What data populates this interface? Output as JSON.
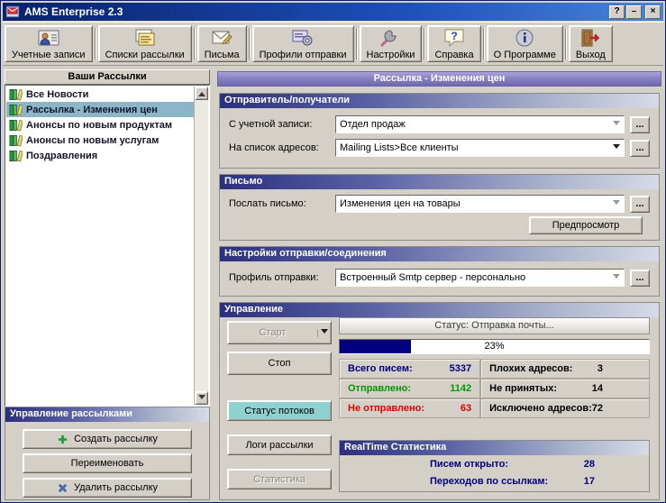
{
  "window": {
    "title": "AMS Enterprise 2.3",
    "help": "?",
    "minimize": "–",
    "close": "×"
  },
  "toolbar": {
    "items": [
      {
        "label": "Учетные записи",
        "icon": "accounts-icon"
      },
      {
        "label": "Списки рассылки",
        "icon": "mailing-lists-icon"
      },
      {
        "label": "Письма",
        "icon": "letters-icon"
      },
      {
        "label": "Профили отправки",
        "icon": "send-profiles-icon"
      },
      {
        "label": "Настройки",
        "icon": "settings-icon"
      },
      {
        "label": "Справка",
        "icon": "help-icon"
      },
      {
        "label": "О Программе",
        "icon": "about-icon"
      },
      {
        "label": "Выход",
        "icon": "exit-icon"
      }
    ]
  },
  "sidebar": {
    "header": "Ваши Рассылки",
    "items": [
      {
        "label": "Все Новости",
        "selected": false
      },
      {
        "label": "Рассылка - Изменения цен",
        "selected": true
      },
      {
        "label": "Анонсы по новым продуктам",
        "selected": false
      },
      {
        "label": "Анонсы по новым услугам",
        "selected": false
      },
      {
        "label": "Поздравления",
        "selected": false
      }
    ],
    "management": {
      "header": "Управление рассылками",
      "create_label": "Создать рассылку",
      "rename_label": "Переименовать",
      "delete_label": "Удалить рассылку"
    }
  },
  "main": {
    "title": "Рассылка - Изменения цен",
    "sender": {
      "header": "Отправитель/получатели",
      "account_label": "С учетной записи:",
      "account_value": "Отдел продаж",
      "list_label": "На список адресов:",
      "list_value": "Mailing Lists>Все клиенты"
    },
    "letter": {
      "header": "Письмо",
      "label": "Послать письмо:",
      "value": "Изменения цен на товары",
      "preview_label": "Предпросмотр"
    },
    "send_settings": {
      "header": "Настройки отправки/соединения",
      "profile_label": "Профиль отправки:",
      "profile_value": "Встроенный Smtp сервер - персонально"
    },
    "control": {
      "header": "Управление",
      "start_label": "Старт",
      "stop_label": "Стоп",
      "threads_label": "Статус потоков",
      "logs_label": "Логи рассылки",
      "stats_label": "Статистика",
      "status_text": "Статус: Отправка почты...",
      "progress_percent": "23%",
      "progress_value": 23,
      "stats": [
        {
          "label": "Всего писем:",
          "value": "5337"
        },
        {
          "label": "Плохих адресов:",
          "value": "3"
        },
        {
          "label": "Отправлено:",
          "value": "1142"
        },
        {
          "label": "Не принятых:",
          "value": "14"
        },
        {
          "label": "Не отправлено:",
          "value": "63"
        },
        {
          "label": "Исключено адресов:",
          "value": "72"
        }
      ],
      "realtime": {
        "header": "RealTime Статистика",
        "opened_label": "Писем открыто:",
        "opened_value": "28",
        "clicks_label": "Переходов по ссылкам:",
        "clicks_value": "17"
      }
    }
  },
  "ui": {
    "browse_label": "...",
    "icons": {
      "dropdown": "triangle-down-css-shape",
      "scroll_up": "triangle-up-css-shape",
      "scroll_down": "triangle-down-css-shape",
      "create": "green-plus",
      "delete": "blue-cross",
      "list_item": "books-stack"
    }
  },
  "colors": {
    "titlebar_blue": "#1d4fb8",
    "header_navy": "#2c2f7e",
    "title_purple": "#8982c2",
    "selection_teal": "#8cb6c8",
    "progress_navy": "#000080",
    "sent_green": "#009900",
    "not_sent_red": "#e00000",
    "threads_button_teal": "#8ed2d0"
  }
}
